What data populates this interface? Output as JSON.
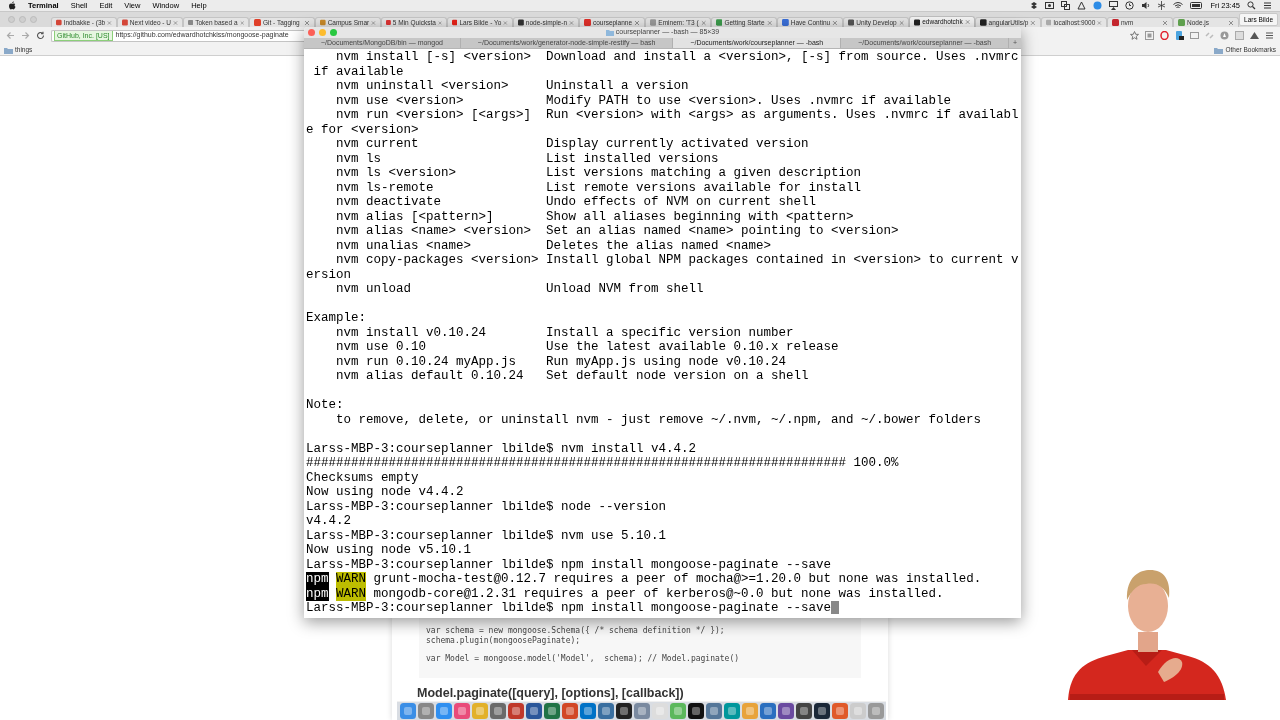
{
  "menubar": {
    "app": "Terminal",
    "menus": [
      "Shell",
      "Edit",
      "View",
      "Window",
      "Help"
    ],
    "clock": "Fri 23:45"
  },
  "browser": {
    "tabs": [
      {
        "label": "Indbakke - (3b",
        "selected": false
      },
      {
        "label": "Next video - U",
        "selected": false
      },
      {
        "label": "Token based a",
        "selected": false
      },
      {
        "label": "Git - Tagging",
        "selected": false
      },
      {
        "label": "Campus Smar",
        "selected": false
      },
      {
        "label": "5 Min Quicksta",
        "selected": false
      },
      {
        "label": "Lars Bilde - Yo",
        "selected": false
      },
      {
        "label": "node-simple-n",
        "selected": false
      },
      {
        "label": "courseplanne",
        "selected": false
      },
      {
        "label": "Eminem: 'T3 (",
        "selected": false
      },
      {
        "label": "Getting Starte",
        "selected": false
      },
      {
        "label": "Have Continu",
        "selected": false
      },
      {
        "label": "Unity Develop",
        "selected": false
      },
      {
        "label": "edwardhotchk",
        "selected": true
      },
      {
        "label": "angularUtils/p",
        "selected": false
      },
      {
        "label": "localhost:9000",
        "selected": false
      },
      {
        "label": "nvm",
        "selected": false
      },
      {
        "label": "Node.js",
        "selected": false
      }
    ],
    "profile": "Lars Bilde",
    "security_badge": "GitHub, Inc. [US]",
    "url": "https://github.com/edwardhotchkiss/mongoose-paginate",
    "bookmarks": [
      "things"
    ],
    "other_bookmarks": "Other Bookmarks",
    "page": {
      "code_lines": [
        {
          "kind": "code",
          "text": "var schema = new mongoose.Schema({ /* schema definition */ });"
        },
        {
          "kind": "code",
          "text": "schema.plugin(mongoosePaginate);"
        },
        {
          "kind": "blank"
        },
        {
          "kind": "code",
          "text": "var Model = mongoose.model('Model',  schema); // Model.paginate()"
        }
      ],
      "heading": "Model.paginate([query], [options], [callback])"
    }
  },
  "terminal": {
    "title": "courseplanner — -bash — 85×39",
    "tabs": [
      {
        "label": "~/Documents/MongoDB/bin — mongod",
        "selected": false
      },
      {
        "label": "~/Documents/work/generator-node-simple-restify — bash",
        "selected": false
      },
      {
        "label": "~/Documents/work/courseplanner — -bash",
        "selected": true
      },
      {
        "label": "~/Documents/work/courseplanner — -bash",
        "selected": false
      }
    ],
    "new_tab": "+",
    "cursor": true,
    "lines": [
      {
        "kind": "text",
        "text": "    nvm install [-s] <version>  Download and install a <version>, [-s] from source. Uses .nvmrc"
      },
      {
        "kind": "text",
        "text": " if available"
      },
      {
        "kind": "text",
        "text": "    nvm uninstall <version>     Uninstall a version"
      },
      {
        "kind": "text",
        "text": "    nvm use <version>           Modify PATH to use <version>. Uses .nvmrc if available"
      },
      {
        "kind": "text",
        "text": "    nvm run <version> [<args>]  Run <version> with <args> as arguments. Uses .nvmrc if availabl"
      },
      {
        "kind": "text",
        "text": "e for <version>"
      },
      {
        "kind": "text",
        "text": "    nvm current                 Display currently activated version"
      },
      {
        "kind": "text",
        "text": "    nvm ls                      List installed versions"
      },
      {
        "kind": "text",
        "text": "    nvm ls <version>            List versions matching a given description"
      },
      {
        "kind": "text",
        "text": "    nvm ls-remote               List remote versions available for install"
      },
      {
        "kind": "text",
        "text": "    nvm deactivate              Undo effects of NVM on current shell"
      },
      {
        "kind": "text",
        "text": "    nvm alias [<pattern>]       Show all aliases beginning with <pattern>"
      },
      {
        "kind": "text",
        "text": "    nvm alias <name> <version>  Set an alias named <name> pointing to <version>"
      },
      {
        "kind": "text",
        "text": "    nvm unalias <name>          Deletes the alias named <name>"
      },
      {
        "kind": "text",
        "text": "    nvm copy-packages <version> Install global NPM packages contained in <version> to current v"
      },
      {
        "kind": "text",
        "text": "ersion"
      },
      {
        "kind": "text",
        "text": "    nvm unload                  Unload NVM from shell"
      },
      {
        "kind": "blank"
      },
      {
        "kind": "text",
        "text": "Example:"
      },
      {
        "kind": "text",
        "text": "    nvm install v0.10.24        Install a specific version number"
      },
      {
        "kind": "text",
        "text": "    nvm use 0.10                Use the latest available 0.10.x release"
      },
      {
        "kind": "text",
        "text": "    nvm run 0.10.24 myApp.js    Run myApp.js using node v0.10.24"
      },
      {
        "kind": "text",
        "text": "    nvm alias default 0.10.24   Set default node version on a shell"
      },
      {
        "kind": "blank"
      },
      {
        "kind": "text",
        "text": "Note:"
      },
      {
        "kind": "text",
        "text": "    to remove, delete, or uninstall nvm - just remove ~/.nvm, ~/.npm, and ~/.bower folders"
      },
      {
        "kind": "blank"
      },
      {
        "kind": "text",
        "text": "Larss-MBP-3:courseplanner lbilde$ nvm install v4.4.2"
      },
      {
        "kind": "text",
        "text": "######################################################################## 100.0%"
      },
      {
        "kind": "text",
        "text": "Checksums empty"
      },
      {
        "kind": "text",
        "text": "Now using node v4.4.2"
      },
      {
        "kind": "text",
        "text": "Larss-MBP-3:courseplanner lbilde$ node --version"
      },
      {
        "kind": "text",
        "text": "v4.4.2"
      },
      {
        "kind": "text",
        "text": "Larss-MBP-3:courseplanner lbilde$ nvm use 5.10.1"
      },
      {
        "kind": "text",
        "text": "Now using node v5.10.1"
      },
      {
        "kind": "text",
        "text": "Larss-MBP-3:courseplanner lbilde$ npm install mongoose-paginate --save"
      },
      {
        "kind": "warn",
        "source": "npm",
        "badge": "WARN",
        "text": "grunt-mocha-test@0.12.7 requires a peer of mocha@>=1.20.0 but none was installed."
      },
      {
        "kind": "warn",
        "source": "npm",
        "badge": "WARN",
        "text": "mongodb-core@1.2.31 requires a peer of kerberos@~0.0 but none was installed."
      },
      {
        "kind": "text",
        "text": "Larss-MBP-3:courseplanner lbilde$ npm install mongoose-paginate --save"
      }
    ]
  }
}
